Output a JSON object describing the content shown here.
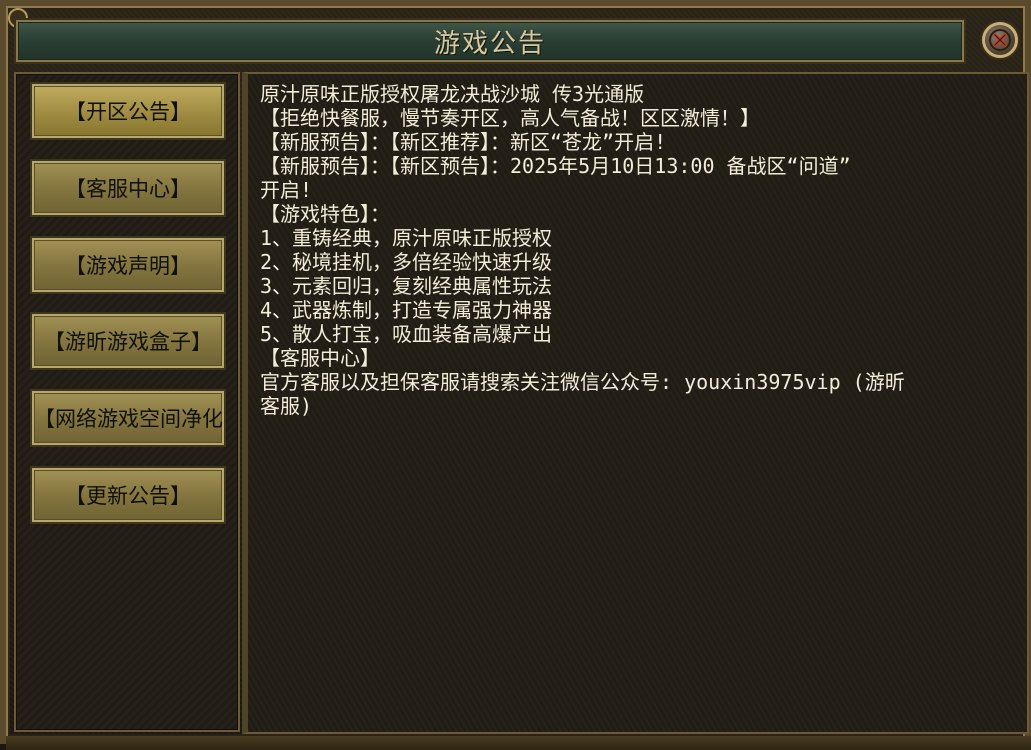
{
  "window": {
    "title": "游戏公告"
  },
  "sidebar": {
    "items": [
      {
        "label": "【开区公告】",
        "active": true
      },
      {
        "label": "【客服中心】",
        "active": false
      },
      {
        "label": "【游戏声明】",
        "active": false
      },
      {
        "label": "【游昕游戏盒子】",
        "active": false
      },
      {
        "label": "【网络游戏空间净化",
        "active": false
      },
      {
        "label": "【更新公告】",
        "active": false
      }
    ]
  },
  "content": {
    "lines": [
      "原汁原味正版授权屠龙决战沙城 传3光通版",
      "【拒绝快餐服，慢节奏开区，高人气备战！区区激情！】",
      "【新服预告】：【新区推荐】：新区“苍龙”开启!",
      "【新服预告】：【新区预告】：2025年5月10日13:00 备战区“问道”",
      "开启!",
      "【游戏特色】：",
      "1、重铸经典，原汁原味正版授权",
      "2、秘境挂机，多倍经验快速升级",
      "3、元素回归，复刻经典属性玩法",
      "4、武器炼制，打造专属强力神器",
      "5、散人打宝，吸血装备高爆产出",
      "【客服中心】",
      "官方客服以及担保客服请搜索关注微信公众号: youxin3975vip (游昕",
      "客服)"
    ]
  },
  "icons": {
    "close": "close-icon"
  },
  "colors": {
    "title_bar": "#2b3f34",
    "button_gold": "#a28f44",
    "text": "#f2ecd8"
  }
}
